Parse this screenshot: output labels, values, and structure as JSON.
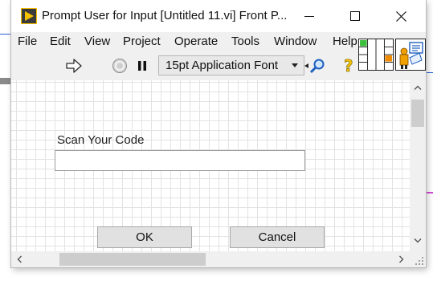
{
  "window": {
    "title": "Prompt User for Input [Untitled 11.vi] Front P...",
    "controls": {
      "minimize_icon": "minimize-icon",
      "maximize_icon": "maximize-icon",
      "close_icon": "close-icon"
    }
  },
  "menubar": {
    "items": [
      {
        "label": "File"
      },
      {
        "label": "Edit"
      },
      {
        "label": "View"
      },
      {
        "label": "Project"
      },
      {
        "label": "Operate"
      },
      {
        "label": "Tools"
      },
      {
        "label": "Window"
      },
      {
        "label": "Help"
      }
    ]
  },
  "toolbar": {
    "run_icon": "run-arrow-icon",
    "abort_icon": "abort-execution-icon",
    "pause_icon": "pause-icon",
    "font_select": "15pt Application Font",
    "align_icon": "align-search-icon",
    "help_icon": "context-help-icon"
  },
  "form": {
    "scan_label": "Scan Your Code",
    "scan_value": "",
    "ok_label": "OK",
    "cancel_label": "Cancel"
  },
  "colors": {
    "accent": "#2b5fd9",
    "panel_grid": "#e3e3e3",
    "run_arrow": "#2a2a2a",
    "help_yellow": "#f2c200",
    "app_icon_bg": "#f5c000"
  }
}
